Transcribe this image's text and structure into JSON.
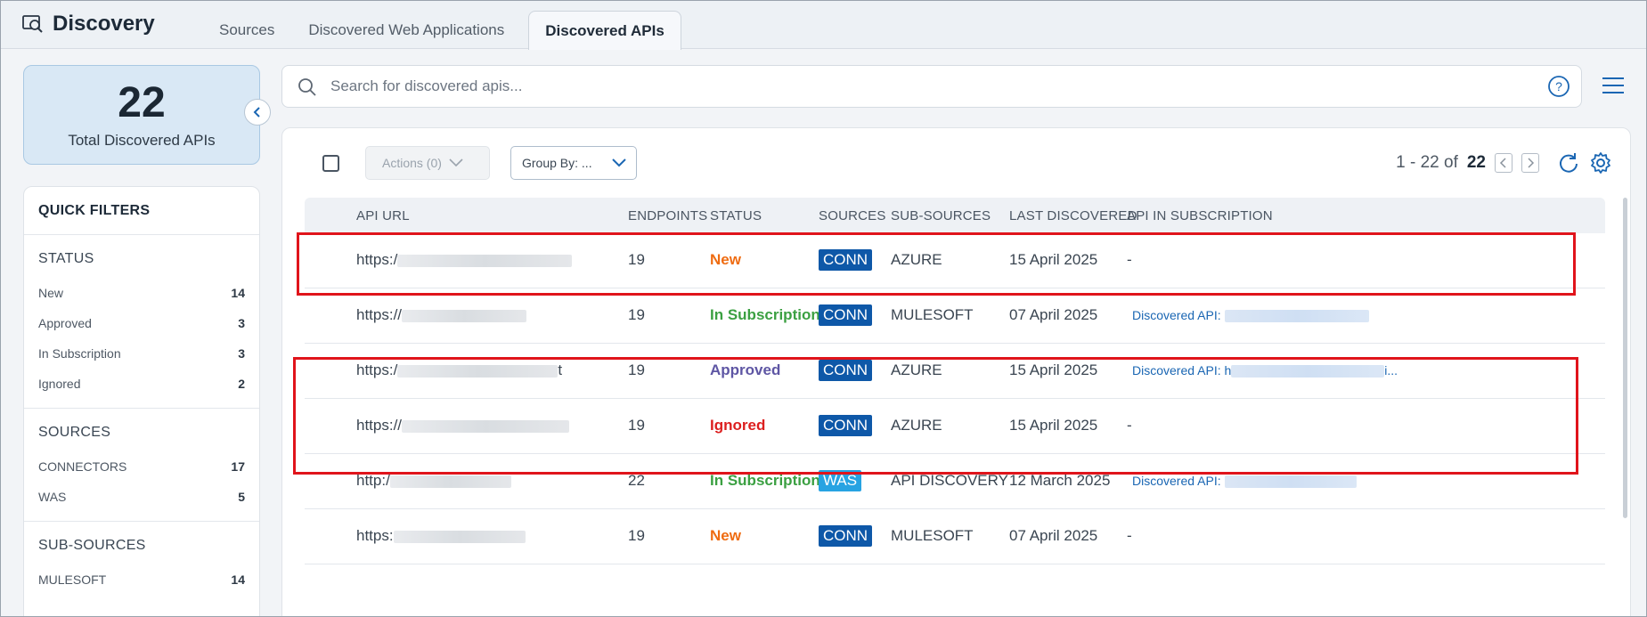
{
  "app": {
    "title": "Discovery"
  },
  "tabs": [
    {
      "label": "Sources"
    },
    {
      "label": "Discovered Web Applications"
    },
    {
      "label": "Discovered APIs"
    }
  ],
  "summary": {
    "count": "22",
    "label": "Total Discovered APIs"
  },
  "filters": {
    "title": "QUICK FILTERS",
    "status": {
      "title": "STATUS",
      "items": [
        {
          "label": "New",
          "count": "14"
        },
        {
          "label": "Approved",
          "count": "3"
        },
        {
          "label": "In Subscription",
          "count": "3"
        },
        {
          "label": "Ignored",
          "count": "2"
        }
      ]
    },
    "sources": {
      "title": "SOURCES",
      "items": [
        {
          "label": "CONNECTORS",
          "count": "17"
        },
        {
          "label": "WAS",
          "count": "5"
        }
      ]
    },
    "subsources": {
      "title": "SUB-SOURCES",
      "items": [
        {
          "label": "MULESOFT",
          "count": "14"
        }
      ]
    }
  },
  "search": {
    "placeholder": "Search for discovered apis..."
  },
  "toolbar": {
    "actions_label": "Actions (0)",
    "group_by_label": "Group By: ...",
    "pager_range": "1 - 22 of",
    "pager_total": "22"
  },
  "table": {
    "columns": [
      "API URL",
      "ENDPOINTS",
      "STATUS",
      "SOURCES",
      "SUB-SOURCES",
      "LAST DISCOVERED",
      "API IN SUBSCRIPTION"
    ],
    "rows": [
      {
        "url": "https:/",
        "url_tail": "",
        "endpoints": "19",
        "status": "New",
        "source": "CONN",
        "subsource": "AZURE",
        "last": "15 April 2025",
        "subscription": "-",
        "sub_prefix": ""
      },
      {
        "url": "https://",
        "url_tail": "",
        "endpoints": "19",
        "status": "In Subscription",
        "source": "CONN",
        "subsource": "MULESOFT",
        "last": "07 April 2025",
        "subscription": "",
        "sub_prefix": "Discovered API: "
      },
      {
        "url": "https:/",
        "url_tail": "t",
        "endpoints": "19",
        "status": "Approved",
        "source": "CONN",
        "subsource": "AZURE",
        "last": "15 April 2025",
        "subscription": "i...",
        "sub_prefix": "Discovered API: h"
      },
      {
        "url": "https://",
        "url_tail": "",
        "endpoints": "19",
        "status": "Ignored",
        "source": "CONN",
        "subsource": "AZURE",
        "last": "15 April 2025",
        "subscription": "-",
        "sub_prefix": ""
      },
      {
        "url": "http:/",
        "url_tail": "",
        "endpoints": "22",
        "status": "In Subscription",
        "source": "WAS",
        "subsource": "API DISCOVERY",
        "last": "12 March 2025",
        "subscription": "",
        "sub_prefix": "Discovered API: "
      },
      {
        "url": "https:",
        "url_tail": "",
        "endpoints": "19",
        "status": "New",
        "source": "CONN",
        "subsource": "MULESOFT",
        "last": "07 April 2025",
        "subscription": "-",
        "sub_prefix": ""
      }
    ]
  },
  "colors": {
    "new": "#ef6c12",
    "in_subscription": "#3ba042",
    "approved": "#5e56a4",
    "ignored": "#dc1f1f",
    "conn_badge": "#0e58a8",
    "was_badge": "#27a3e2",
    "highlight": "#e0141b"
  }
}
